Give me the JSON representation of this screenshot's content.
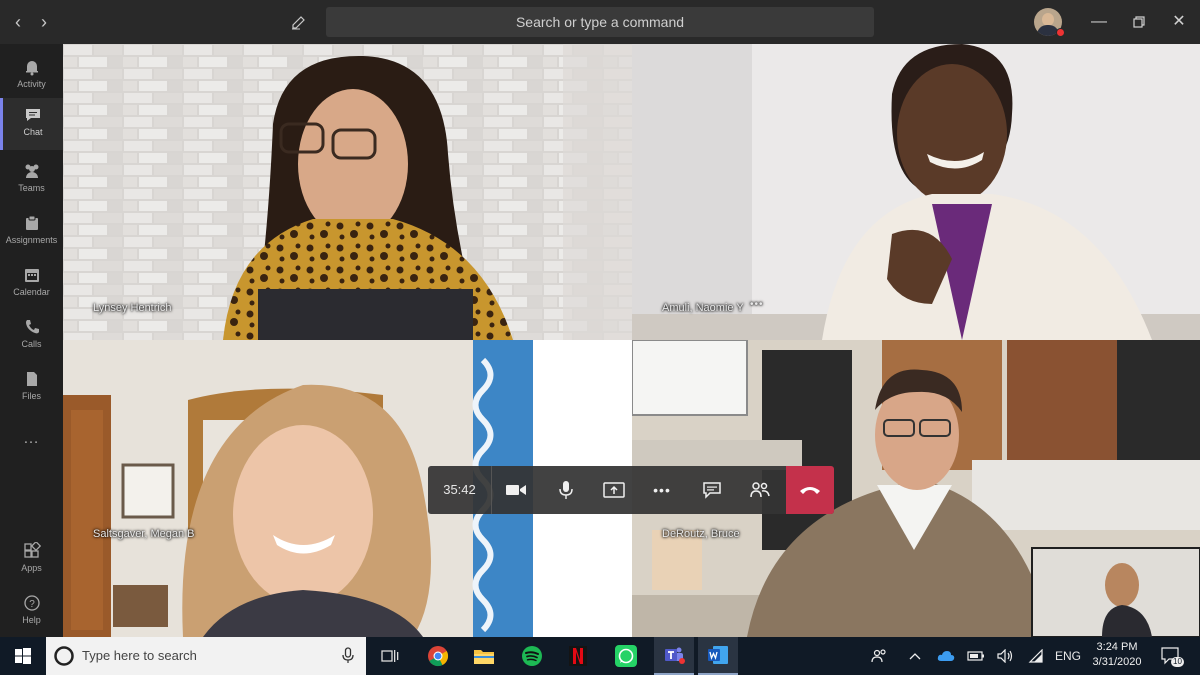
{
  "titlebar": {
    "search_placeholder": "Search or type a command"
  },
  "rail": {
    "items": [
      {
        "label": "Activity",
        "icon": "bell-icon"
      },
      {
        "label": "Chat",
        "icon": "chat-icon"
      },
      {
        "label": "Teams",
        "icon": "teams-icon"
      },
      {
        "label": "Assignments",
        "icon": "assignments-icon"
      },
      {
        "label": "Calendar",
        "icon": "calendar-icon"
      },
      {
        "label": "Calls",
        "icon": "phone-icon"
      },
      {
        "label": "Files",
        "icon": "file-icon"
      },
      {
        "label": "…",
        "icon": "more-icon"
      },
      {
        "label": "Apps",
        "icon": "apps-icon"
      },
      {
        "label": "Help",
        "icon": "help-icon"
      }
    ]
  },
  "participants": [
    {
      "name": "Lynsey Hentrich"
    },
    {
      "name": "Amuli, Naomie Y"
    },
    {
      "name": "Saltsgaver, Megan B"
    },
    {
      "name": "DeRoutz, Bruce"
    }
  ],
  "call": {
    "timer": "35:42",
    "more_glyph": "•••",
    "name_more": "•••"
  },
  "taskbar": {
    "search_placeholder": "Type here to search",
    "language": "ENG",
    "time": "3:24 PM",
    "date": "3/31/2020",
    "notifications": "10"
  },
  "colors": {
    "accent": "#7b83eb",
    "hangup": "#c4314b",
    "titlebar": "#292929",
    "taskbar": "#101a26"
  }
}
